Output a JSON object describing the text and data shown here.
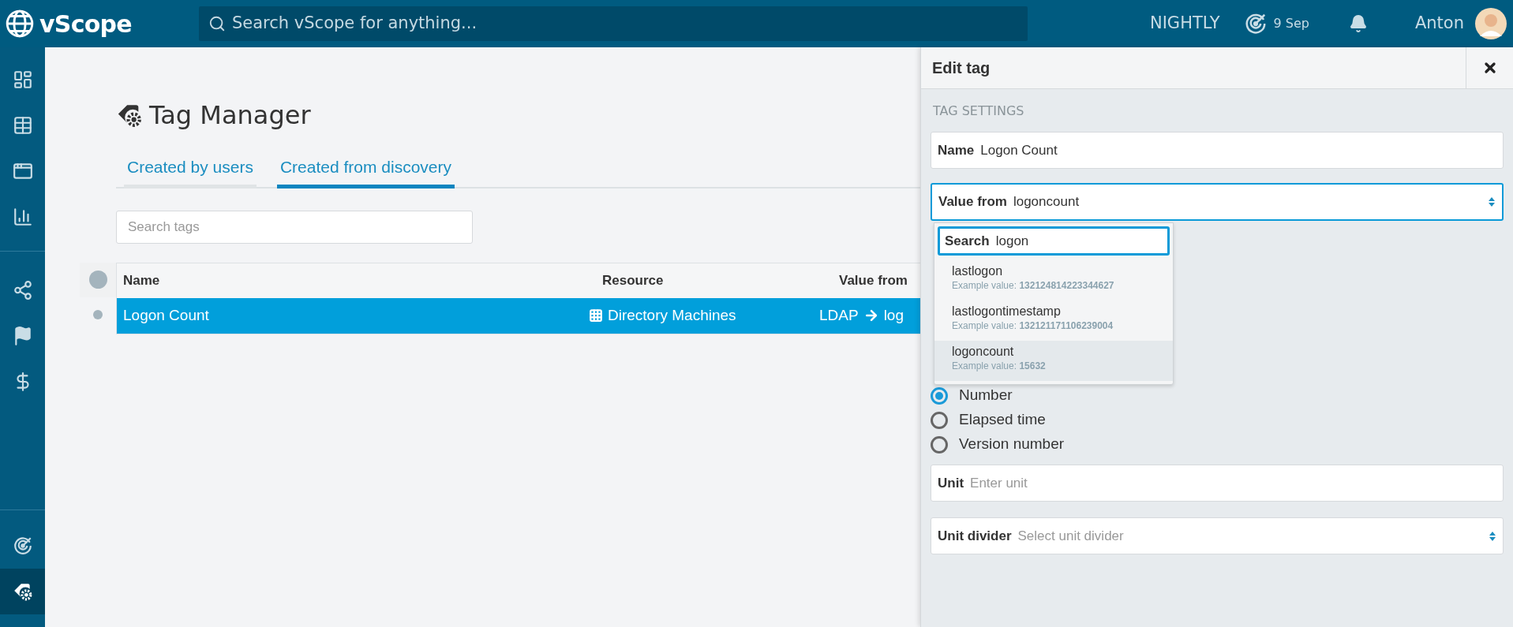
{
  "app": {
    "name": "vScope"
  },
  "search": {
    "placeholder": "Search vScope for anything..."
  },
  "topbar": {
    "environment": "NIGHTLY",
    "date": "9 Sep",
    "user": "Anton"
  },
  "sidebar": {
    "sections": [
      {
        "items": [
          {
            "kind": "dashboard",
            "selected": false
          },
          {
            "kind": "table",
            "selected": false
          },
          {
            "kind": "window",
            "selected": false
          },
          {
            "kind": "chart",
            "selected": false
          }
        ]
      },
      {
        "items": [
          {
            "kind": "share",
            "selected": false
          },
          {
            "kind": "flag",
            "selected": false
          },
          {
            "kind": "dollar",
            "selected": false
          }
        ]
      },
      {
        "items": [
          {
            "kind": "radar",
            "selected": false
          },
          {
            "kind": "tag",
            "selected": true
          }
        ]
      }
    ]
  },
  "page": {
    "title": "Tag Manager",
    "tabs": [
      {
        "label": "Created by users",
        "selected": false
      },
      {
        "label": "Created from discovery",
        "selected": true
      }
    ],
    "search_tags": {
      "placeholder": "Search tags"
    },
    "table": {
      "columns": [
        "Name",
        "Resource",
        "Value from"
      ],
      "rows": [
        {
          "name": "Logon Count",
          "resource": "Directory Machines",
          "source": "LDAP",
          "attribute": "log",
          "selected": true
        }
      ]
    }
  },
  "panel": {
    "title": "Edit tag",
    "section": "TAG SETTINGS",
    "name_field": {
      "label": "Name",
      "value": "Logon Count"
    },
    "value_from": {
      "label": "Value from",
      "value": "logoncount",
      "focused": true
    },
    "dropdown": {
      "search_label": "Search",
      "search_value": "logon",
      "options": [
        {
          "name": "lastlogon",
          "example": "Example value: **132124814223344627**",
          "selected": false
        },
        {
          "name": "lastlogontimestamp",
          "example": "Example value: **132121171106239004**",
          "selected": false
        },
        {
          "name": "logoncount",
          "example": "Example value: **15632**",
          "selected": true
        }
      ]
    },
    "radios": [
      {
        "label": "Number",
        "selected": true
      },
      {
        "label": "Elapsed time",
        "selected": false
      },
      {
        "label": "Version number",
        "selected": false
      }
    ],
    "unit": {
      "label": "Unit",
      "placeholder": "Enter unit"
    },
    "unit_divider": {
      "label": "Unit divider",
      "placeholder": "Select unit divider"
    }
  }
}
